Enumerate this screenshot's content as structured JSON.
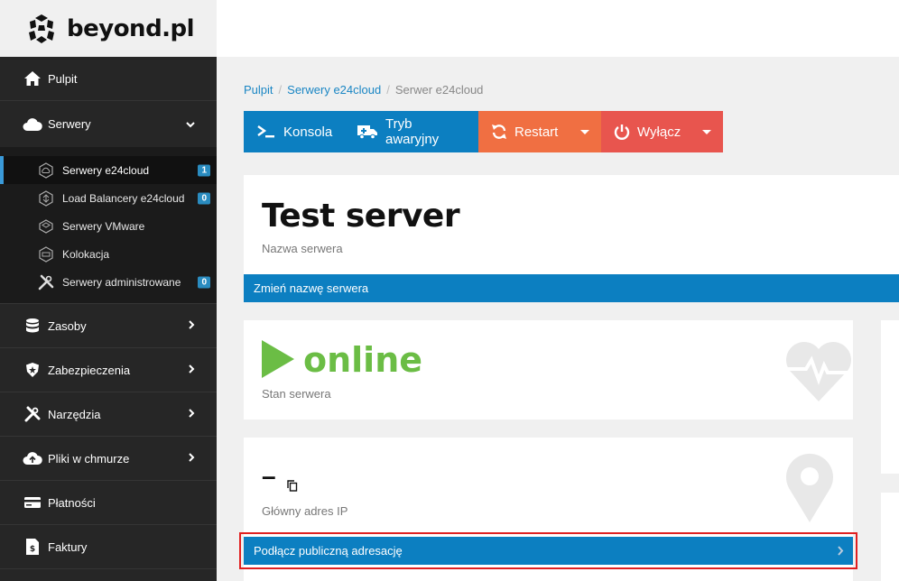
{
  "logo": {
    "text": "beyond.pl"
  },
  "sidebar": {
    "items": [
      {
        "label": "Pulpit",
        "icon": "home-icon"
      },
      {
        "label": "Serwery",
        "icon": "cloud-icon",
        "expanded": true
      },
      {
        "label": "Zasoby",
        "icon": "database-icon"
      },
      {
        "label": "Zabezpieczenia",
        "icon": "shield-icon"
      },
      {
        "label": "Narzędzia",
        "icon": "tools-icon"
      },
      {
        "label": "Pliki w chmurze",
        "icon": "cloud-upload-icon"
      },
      {
        "label": "Płatności",
        "icon": "credit-card-icon"
      },
      {
        "label": "Faktury",
        "icon": "invoice-icon"
      }
    ],
    "servers_sub": [
      {
        "label": "Serwery e24cloud",
        "badge": "1",
        "active": true
      },
      {
        "label": "Load Balancery e24cloud",
        "badge": "0"
      },
      {
        "label": "Serwery VMware",
        "badge": ""
      },
      {
        "label": "Kolokacja",
        "badge": ""
      },
      {
        "label": "Serwery administrowane",
        "badge": "0"
      }
    ]
  },
  "breadcrumb": {
    "items": [
      "Pulpit",
      "Serwery e24cloud",
      "Serwer e24cloud"
    ]
  },
  "toolbar": {
    "console": "Konsola",
    "emergency": "Tryb awaryjny",
    "restart": "Restart",
    "shutdown": "Wyłącz"
  },
  "server": {
    "name": "Test server",
    "name_label": "Nazwa serwera",
    "rename_link": "Zmień nazwę serwera",
    "status": "online",
    "status_label": "Stan serwera",
    "ip": "–",
    "ip_label": "Główny adres IP",
    "attach_link": "Podłącz publiczną adresację"
  },
  "colors": {
    "accent_blue": "#0c7fc1",
    "restart_orange": "#f06f42",
    "shutdown_red": "#e8554e",
    "online_green": "#6bbd45",
    "sidebar_bg": "#262626"
  }
}
